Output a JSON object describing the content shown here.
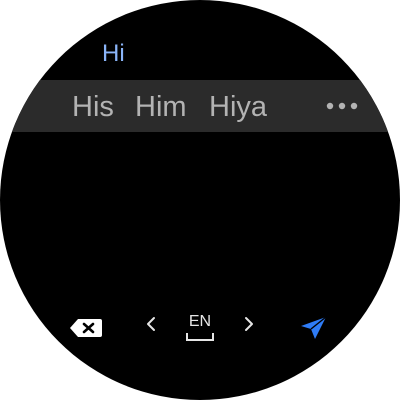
{
  "input": {
    "typed_text": "Hi"
  },
  "suggestions": [
    "His",
    "Him",
    "Hiya"
  ],
  "more_options": {
    "icon": "more-horizontal-icon"
  },
  "toolbar": {
    "backspace_icon": "backspace-icon",
    "prev_language_icon": "chevron-left-icon",
    "language_label": "EN",
    "space_icon": "space-bar-icon",
    "next_language_icon": "chevron-right-icon",
    "send_icon": "send-icon"
  },
  "colors": {
    "background": "#000000",
    "typed_text": "#8ab4f8",
    "suggestion_bar": "#2b2b2b",
    "suggestion_text": "#b3b3b3",
    "accent": "#2f7cf6"
  }
}
